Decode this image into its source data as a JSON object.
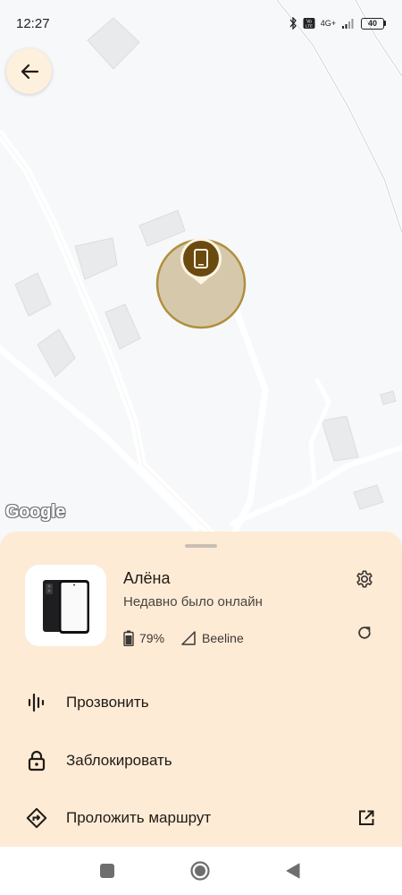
{
  "status_bar": {
    "time": "12:27",
    "network": "4G+",
    "battery": "40"
  },
  "map": {
    "attribution": "Google",
    "marker_icon": "phone-icon",
    "accuracy_color": "#d6c9ab",
    "marker_color": "#6b4a10"
  },
  "device": {
    "name": "Алёна",
    "status": "Недавно было онлайн",
    "battery": "79%",
    "carrier": "Beeline"
  },
  "actions": [
    {
      "label": "Прозвонить",
      "icon": "sound-icon"
    },
    {
      "label": "Заблокировать",
      "icon": "lock-icon"
    },
    {
      "label": "Проложить маршрут",
      "icon": "directions-icon",
      "trailing_icon": "open-external-icon"
    }
  ],
  "colors": {
    "sheet": "#fdebd6",
    "back_button": "#fdf0dc"
  }
}
